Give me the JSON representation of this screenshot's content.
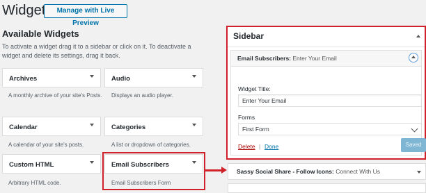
{
  "header": {
    "title": "Widgets",
    "live_preview_label": "Manage with Live Preview"
  },
  "available": {
    "title": "Available Widgets",
    "description": "To activate a widget drag it to a sidebar or click on it. To deactivate a widget and delete its settings, drag it back.",
    "widgets": [
      {
        "title": "Archives",
        "description": "A monthly archive of your site's Posts."
      },
      {
        "title": "Audio",
        "description": "Displays an audio player."
      },
      {
        "title": "Calendar",
        "description": "A calendar of your site's posts."
      },
      {
        "title": "Categories",
        "description": "A list or dropdown of categories."
      },
      {
        "title": "Custom HTML",
        "description": "Arbitrary HTML code."
      },
      {
        "title": "Email Subscribers",
        "description": "Email Subscribers Form"
      }
    ]
  },
  "sidebar": {
    "title": "Sidebar",
    "widget": {
      "name": "Email Subscribers:",
      "subtitle": "Enter Your Email",
      "title_label": "Widget Title:",
      "title_value": "Enter Your Email",
      "forms_label": "Forms",
      "forms_value": "First Form",
      "delete_label": "Delete",
      "separator": "|",
      "done_label": "Done",
      "saved_label": "Saved"
    },
    "next_widget": {
      "name": "Sassy Social Share - Follow Icons:",
      "subtitle": "Connect With Us"
    }
  },
  "colors": {
    "highlight": "#d0202a",
    "link": "#0073aa",
    "delete": "#a00000",
    "saved_button": "#7fb6d4"
  }
}
